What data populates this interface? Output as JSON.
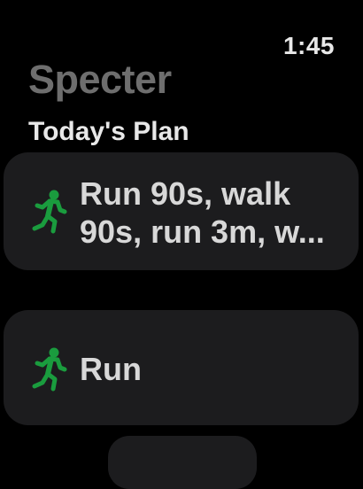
{
  "status": {
    "time": "1:45"
  },
  "app": {
    "title": "Specter"
  },
  "section": {
    "header": "Today's Plan"
  },
  "workouts": [
    {
      "icon": "running-figure-icon",
      "label_lines": [
        "Run 90s, walk",
        "90s, run 3m, w..."
      ]
    },
    {
      "icon": "running-figure-icon",
      "label_lines": [
        "Run"
      ]
    }
  ],
  "colors": {
    "background": "#000000",
    "card": "#1c1c1e",
    "accent_green": "#1a9c3e",
    "title_gray": "#6e6e6e",
    "text": "#d8d8d8"
  }
}
